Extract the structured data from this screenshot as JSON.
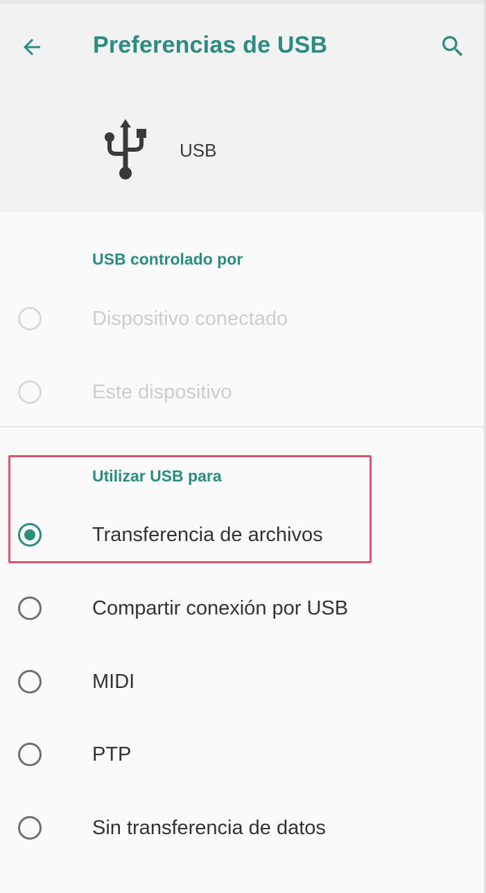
{
  "header": {
    "back_icon": "arrow-left-icon",
    "title": "Preferencias de USB",
    "search_icon": "search-icon",
    "device_icon": "usb-icon",
    "device_label": "USB"
  },
  "sections": {
    "controlled_by": {
      "title": "USB controlado por",
      "options": [
        {
          "label": "Dispositivo conectado",
          "checked": false,
          "enabled": false
        },
        {
          "label": "Este dispositivo",
          "checked": false,
          "enabled": false
        }
      ]
    },
    "use_for": {
      "title": "Utilizar USB para",
      "options": [
        {
          "label": "Transferencia de archivos",
          "checked": true,
          "enabled": true
        },
        {
          "label": "Compartir conexión por USB",
          "checked": false,
          "enabled": true
        },
        {
          "label": "MIDI",
          "checked": false,
          "enabled": true
        },
        {
          "label": "PTP",
          "checked": false,
          "enabled": true
        },
        {
          "label": "Sin transferencia de datos",
          "checked": false,
          "enabled": true
        }
      ]
    }
  },
  "colors": {
    "accent": "#2b8c7f",
    "highlight_border": "#d9546a",
    "header_bg": "#f2f2f2",
    "body_bg": "#fafafa"
  }
}
